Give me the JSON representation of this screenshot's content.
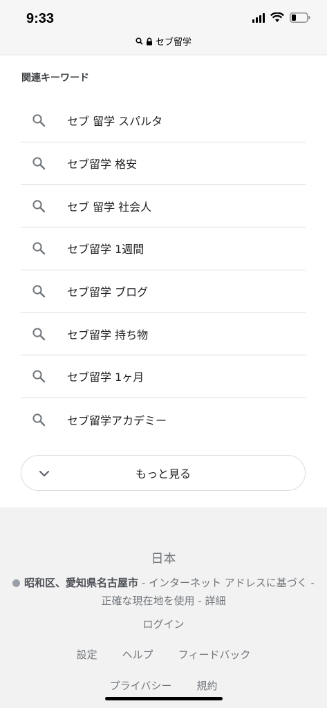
{
  "status_bar": {
    "time": "9:33"
  },
  "browser": {
    "url_text": "セブ留学"
  },
  "related": {
    "title": "関連キーワード",
    "items": [
      {
        "label": "セブ 留学 スパルタ"
      },
      {
        "label": "セブ留学 格安"
      },
      {
        "label": "セブ 留学 社会人"
      },
      {
        "label": "セブ留学 1週間"
      },
      {
        "label": "セブ留学 ブログ"
      },
      {
        "label": "セブ留学 持ち物"
      },
      {
        "label": "セブ留学 1ヶ月"
      },
      {
        "label": "セブ留学アカデミー"
      }
    ],
    "more_label": "もっと見る"
  },
  "footer": {
    "country": "日本",
    "location_bold": "昭和区、愛知県名古屋市",
    "location_rest1": " - インターネット アドレスに基づく - ",
    "location_link": "正確な現在地を使用",
    "location_sep": " - ",
    "location_details": "詳細",
    "login": "ログイン",
    "settings": "設定",
    "help": "ヘルプ",
    "feedback": "フィードバック",
    "privacy": "プライバシー",
    "terms": "規約"
  }
}
